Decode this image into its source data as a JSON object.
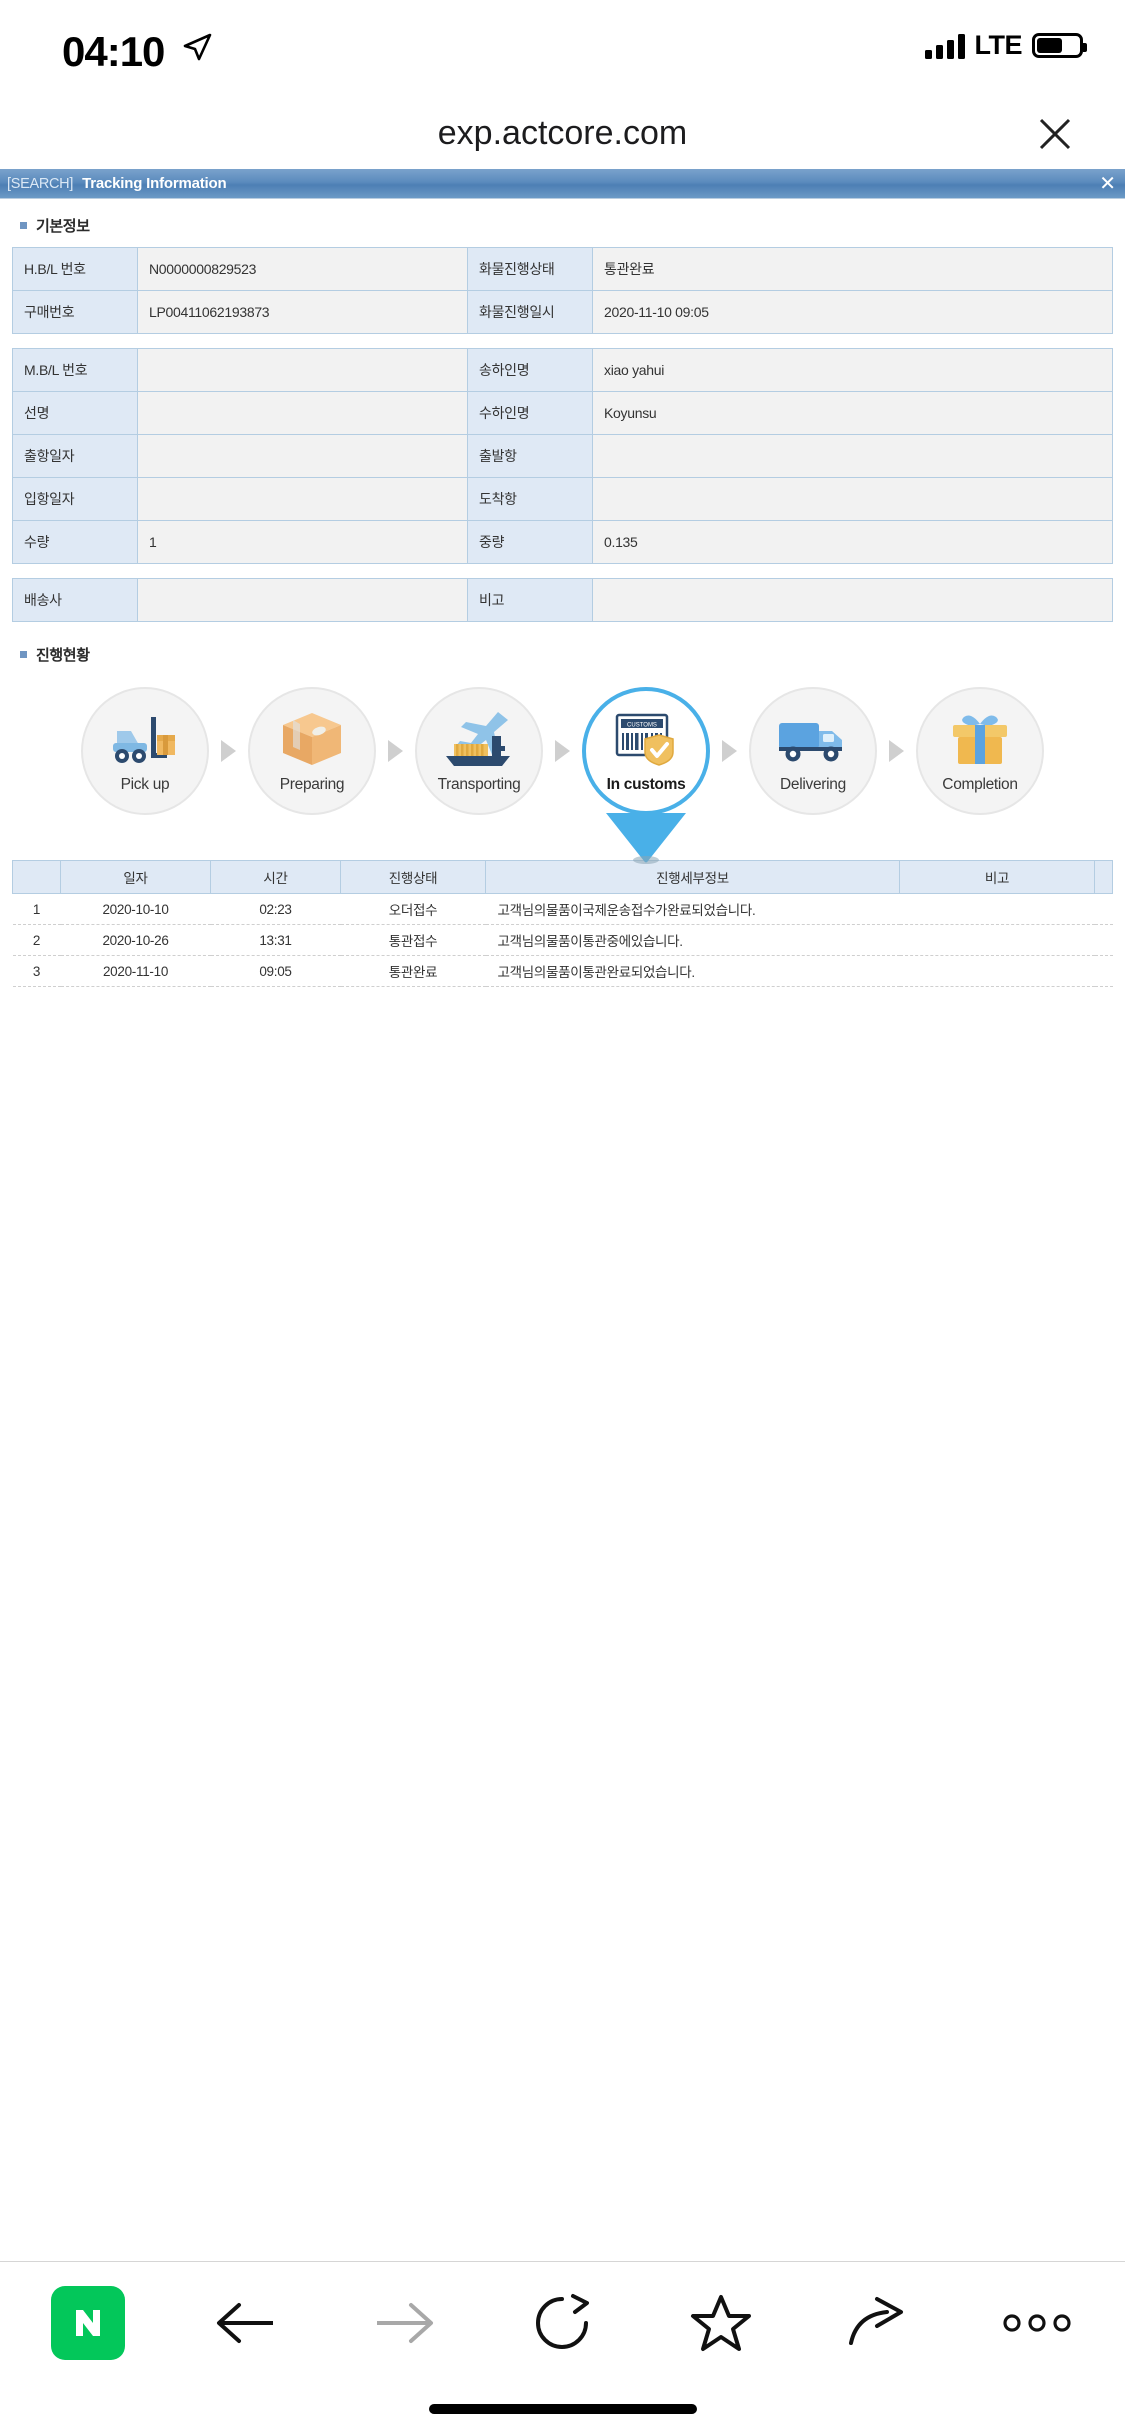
{
  "status_bar": {
    "time": "04:10",
    "carrier": "LTE",
    "location_icon": "location-arrow-icon",
    "signal_icon": "signal-bars-icon",
    "battery_icon": "battery-icon"
  },
  "browser_header": {
    "url": "exp.actcore.com",
    "close_icon": "close-icon"
  },
  "title_bar": {
    "search_tag": "[SEARCH]",
    "title": "Tracking Information",
    "close": "✕"
  },
  "basic_section": {
    "heading": "기본정보",
    "block1": [
      {
        "label1": "H.B/L 번호",
        "value1": "N0000000829523",
        "label2": "화물진행상태",
        "value2": "통관완료"
      },
      {
        "label1": "구매번호",
        "value1": "LP00411062193873",
        "label2": "화물진행일시",
        "value2": "2020-11-10 09:05"
      }
    ],
    "block2": [
      {
        "label1": "M.B/L 번호",
        "value1": "",
        "label2": "송하인명",
        "value2": "xiao yahui"
      },
      {
        "label1": "선명",
        "value1": "",
        "label2": "수하인명",
        "value2": "Koyunsu"
      },
      {
        "label1": "출항일자",
        "value1": "",
        "label2": "출발항",
        "value2": ""
      },
      {
        "label1": "입항일자",
        "value1": "",
        "label2": "도착항",
        "value2": ""
      },
      {
        "label1": "수량",
        "value1": "1",
        "label2": "중량",
        "value2": "0.135"
      }
    ],
    "block3": [
      {
        "label1": "배송사",
        "value1": "",
        "label2": "비고",
        "value2": ""
      }
    ]
  },
  "progress_section": {
    "heading": "진행현황",
    "active_index": 3,
    "steps": [
      {
        "label": "Pick up",
        "icon": "forklift-icon"
      },
      {
        "label": "Preparing",
        "icon": "package-box-icon"
      },
      {
        "label": "Transporting",
        "icon": "plane-ship-icon"
      },
      {
        "label": "In customs",
        "icon": "customs-barcode-shield-icon"
      },
      {
        "label": "Delivering",
        "icon": "delivery-truck-icon"
      },
      {
        "label": "Completion",
        "icon": "gift-box-icon"
      }
    ]
  },
  "history_table": {
    "headers": [
      "",
      "일자",
      "시간",
      "진행상태",
      "진행세부정보",
      "비고",
      ""
    ],
    "rows": [
      {
        "no": "1",
        "date": "2020-10-10",
        "time": "02:23",
        "status": "오더접수",
        "detail": "고객님의물품이국제운송접수가완료되었습니다.",
        "note": ""
      },
      {
        "no": "2",
        "date": "2020-10-26",
        "time": "13:31",
        "status": "통관접수",
        "detail": "고객님의물품이통관중에있습니다.",
        "note": ""
      },
      {
        "no": "3",
        "date": "2020-11-10",
        "time": "09:05",
        "status": "통관완료",
        "detail": "고객님의물품이통관완료되었습니다.",
        "note": ""
      }
    ]
  },
  "bottom_toolbar": {
    "items": [
      {
        "name": "naver-logo",
        "label": "N"
      },
      {
        "name": "back-arrow-icon",
        "label": "back"
      },
      {
        "name": "forward-arrow-icon",
        "label": "forward"
      },
      {
        "name": "reload-icon",
        "label": "reload"
      },
      {
        "name": "star-icon",
        "label": "favorite"
      },
      {
        "name": "share-icon",
        "label": "share"
      },
      {
        "name": "more-dots-icon",
        "label": "more"
      }
    ]
  },
  "colors": {
    "accent_blue": "#4d7fb4",
    "label_bg": "#dfe9f5",
    "value_bg": "#f2f2f2",
    "border": "#b4cde2",
    "active_ring": "#49b0e8",
    "naver_green": "#03c75a"
  }
}
